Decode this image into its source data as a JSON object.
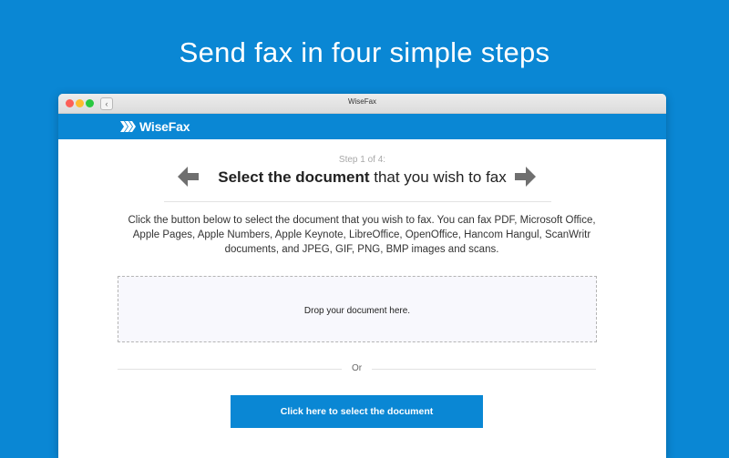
{
  "headline": "Send fax in four simple steps",
  "window": {
    "title": "WiseFax",
    "back_icon": "‹"
  },
  "app": {
    "logo_text": "WiseFax"
  },
  "step": {
    "label": "Step 1 of 4:",
    "title_bold": "Select the document",
    "title_rest": " that you wish to fax"
  },
  "description": "Click the button below to select the document that you wish to fax. You can fax PDF, Microsoft Office, Apple Pages, Apple Numbers, Apple Keynote, LibreOffice, OpenOffice, Hancom Hangul, ScanWritr documents, and JPEG, GIF, PNG, BMP images and scans.",
  "dropzone": {
    "text": "Drop your document here."
  },
  "or_text": "Or",
  "select_button": "Click here to select the document",
  "colors": {
    "brand": "#0a87d4",
    "arrow": "#6f6f6f"
  },
  "icons": {
    "prev": "arrow-left-icon",
    "next": "arrow-right-icon",
    "logo": "wisefax-chevrons-icon"
  }
}
